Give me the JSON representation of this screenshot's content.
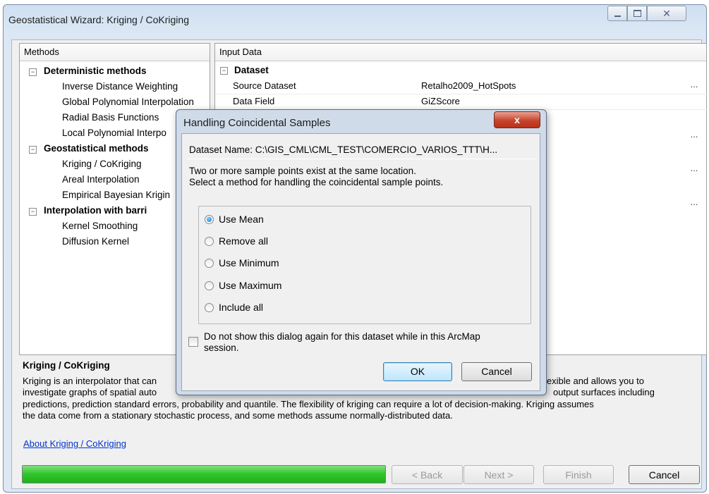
{
  "window": {
    "title": "Geostatistical Wizard: Kriging / CoKriging",
    "caption_buttons": [
      "minimize",
      "restore",
      "close"
    ]
  },
  "methods_panel": {
    "header": "Methods",
    "groups": [
      {
        "label": "Deterministic methods",
        "items": [
          "Inverse Distance Weighting",
          "Global Polynomial Interpolation",
          "Radial Basis Functions",
          "Local Polynomial Interpo"
        ]
      },
      {
        "label": "Geostatistical methods",
        "items": [
          "Kriging / CoKriging",
          "Areal Interpolation",
          "Empirical Bayesian Krigin"
        ]
      },
      {
        "label": "Interpolation with barri",
        "items": [
          "Kernel Smoothing",
          "Diffusion Kernel"
        ]
      }
    ],
    "expand_symbol": "−"
  },
  "input_panel": {
    "header": "Input Data",
    "section": "Dataset",
    "rows": [
      {
        "label": "Source Dataset",
        "value": "Retalho2009_HotSpots"
      },
      {
        "label": "Data Field",
        "value": "GiZScore"
      }
    ],
    "ellipsis": "..."
  },
  "description": {
    "title": "Kriging / CoKriging",
    "line1_left": "Kriging is an interpolator that can",
    "line1_right": "lexible and allows you to",
    "line2_left": "investigate graphs of spatial auto",
    "line2_right": "output surfaces including",
    "line3": "predictions, prediction standard errors, probability and quantile. The flexibility of kriging can require a lot of decision-making. Kriging assumes",
    "line4": "the data come from a stationary stochastic process, and some methods assume normally-distributed data.",
    "link": "About Kriging / CoKriging"
  },
  "footer": {
    "progress": 1.0,
    "back_label": "< Back",
    "next_label": "Next >",
    "finish_label": "Finish",
    "cancel_label": "Cancel"
  },
  "dialog": {
    "title": "Handling Coincidental Samples",
    "close_glyph": "x",
    "dataset_name": "Dataset Name: C:\\GIS_CML\\CML_TEST\\COMERCIO_VARIOS_TTT\\H...",
    "message_line1": "Two or more sample points exist at the same location.",
    "message_line2": "Select a method for handling the coincidental sample points.",
    "options": [
      {
        "label": "Use Mean",
        "selected": true
      },
      {
        "label": "Remove all",
        "selected": false
      },
      {
        "label": "Use Minimum",
        "selected": false
      },
      {
        "label": "Use Maximum",
        "selected": false
      },
      {
        "label": "Include all",
        "selected": false
      }
    ],
    "checkbox_line1": "Do not show this dialog again for this dataset while in this ArcMap",
    "checkbox_line2": "session.",
    "checkbox_checked": false,
    "ok_label": "OK",
    "cancel_label": "Cancel"
  }
}
